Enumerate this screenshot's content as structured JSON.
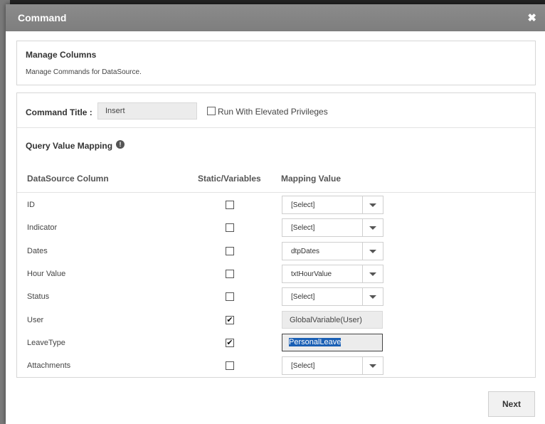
{
  "dialog": {
    "title": "Command",
    "close_glyph": "✖"
  },
  "manage": {
    "title": "Manage Columns",
    "description": "Manage Commands for DataSource."
  },
  "command": {
    "title_label": "Command Title :",
    "title_value": "Insert",
    "elevated_label": "Run With Elevated Privileges",
    "elevated_checked": false
  },
  "mapping": {
    "section_label": "Query Value Mapping",
    "info_icon": "info-icon",
    "headers": {
      "column": "DataSource Column",
      "static": "Static/Variables",
      "value": "Mapping Value"
    },
    "rows": [
      {
        "column": "ID",
        "static": false,
        "value": "[Select]"
      },
      {
        "column": "Indicator",
        "static": false,
        "value": "[Select]"
      },
      {
        "column": "Dates",
        "static": false,
        "value": "dtpDates"
      },
      {
        "column": "Hour Value",
        "static": false,
        "value": "txtHourValue"
      },
      {
        "column": "Status",
        "static": false,
        "value": "[Select]"
      },
      {
        "column": "User",
        "static": true,
        "value": "GlobalVariable(User)"
      },
      {
        "column": "LeaveType",
        "static": true,
        "value": "PersonalLeave"
      },
      {
        "column": "Attachments",
        "static": false,
        "value": "[Select]"
      }
    ]
  },
  "footer": {
    "next_label": "Next"
  },
  "colors": {
    "header_bg": "#858585",
    "selection": "#1a5fb4"
  }
}
